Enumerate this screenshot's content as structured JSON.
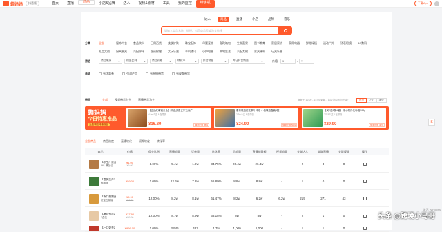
{
  "brand": {
    "name": "蝉妈妈",
    "version": "抖音版"
  },
  "nav": [
    {
      "label": "首页"
    },
    {
      "label": "直播"
    },
    {
      "label": "商品"
    },
    {
      "label": "小店&品牌"
    },
    {
      "label": "达人"
    },
    {
      "label": "视频&素材"
    },
    {
      "label": "工具"
    },
    {
      "label": "我的监控"
    },
    {
      "label": "蝉手机"
    }
  ],
  "top_right": {
    "button": "下载App"
  },
  "search_tabs": [
    "达人",
    "商品",
    "直播",
    "小店",
    "品牌",
    "音乐"
  ],
  "search": {
    "placeholder": "请输入商品名称、链接、抖音商品号或淘宝链接"
  },
  "filters": {
    "category_label": "分类",
    "categories": [
      "全部",
      "服饰内衣",
      "食品饮料",
      "日用百货",
      "美妆护肤",
      "珠宝配饰",
      "母婴宠物",
      "鞋靴箱包",
      "生鲜蔬果",
      "图书教育",
      "家居家纺",
      "家用电器",
      "鲜花绿植",
      "运动户外",
      "钟表眼镜",
      "3C数码",
      "礼品文创",
      "厨具餐具",
      "汽配摩托",
      "医药保健",
      "文玩乐器",
      "手机通讯",
      "小护电器",
      "本地生活",
      "汽配其他",
      "家具建材",
      "玩具乐器"
    ],
    "screen_label": "筛选",
    "selects": [
      "商品来源",
      "佣金比例",
      "商品价格",
      "转化率",
      "抖音销量",
      "昨日抖音销量",
      "价格"
    ],
    "price_range": {
      "from": "¥",
      "to": "¥"
    },
    "advanced_label": "高级",
    "checkboxes": [
      "有优惠券",
      "引流产品",
      "有直播带货",
      "有视频带货"
    ]
  },
  "product_tabs": {
    "label": "带货",
    "tabs": [
      "全部",
      "视频带货为主",
      "直播带货为主"
    ],
    "update": "数据于 12:00 - 14:00 更新，监控范围如何计算？",
    "periods": [
      "昨日",
      "7天",
      "30天"
    ]
  },
  "banner": {
    "title1": "蝉妈妈",
    "title2": "今日特惠推品",
    "badge": "免费领取特惠推品",
    "cards": [
      {
        "name": "【正品红薯蜜汁鱼】鲜活山楂 正宗云南产",
        "sub": "4.9w个达人在带货",
        "price": "¥16.80",
        "tag": "佣金比例 45%"
      },
      {
        "name": "春茶现泡红花茶叶冲泡 小包袋泡盒装3罐",
        "sub": "2.3w个达人在带货",
        "price": "¥24.90",
        "tag": "佣金比例 50%"
      },
      {
        "name": "【买2送2发4罐】 净水机净化冰箱500g",
        "sub": "2793个达人在带货",
        "price": "¥29.90",
        "tag": "佣金比例 40%"
      }
    ]
  },
  "sort_tabs": [
    "全部商品",
    "商品热度",
    "直播转化",
    "视频转化",
    "转化率"
  ],
  "table": {
    "headers": [
      "商品",
      "价格",
      "佣金比例",
      "直播销量",
      "订单量",
      "转化率",
      "总销量",
      "直播销量额",
      "视频销量",
      "关联达人",
      "关联直播",
      "关联视频",
      "操作"
    ],
    "rows": [
      {
        "name": "【原生厂家直销】",
        "name2": "96】黑加仑",
        "price": "¥1.00",
        "price2": "¥9.00",
        "commission": "1.00%",
        "live_sales": "5.4w",
        "orders": "1.9w",
        "conversion": "34.75%",
        "total": "26.4w",
        "live_amount": "26.4w",
        "video_sales": "-",
        "authors": "2",
        "lives": "3",
        "videos": "0"
      },
      {
        "name": "【重庆生产】",
        "name2": "鲜糯糯",
        "price": "¥59.00",
        "price2": "",
        "commission": "1.00%",
        "live_sales": "12.6w",
        "orders": "7.2w",
        "conversion": "56.89%",
        "total": "8.8w",
        "live_amount": "8.8w",
        "video_sales": "-",
        "authors": "1",
        "lives": "0",
        "videos": "0"
      },
      {
        "name": "【新口感嫩蛋",
        "name2": "红宝石辣椒",
        "price": "¥9.90",
        "price2": "¥19.90",
        "commission": "12.00%",
        "live_sales": "8.2w",
        "orders": "8.1w",
        "conversion": "61.47%",
        "total": "8.2w",
        "live_amount": "6.2w",
        "video_sales": "6.2w",
        "authors": "219",
        "lives": "271",
        "videos": "43"
      },
      {
        "name": "【康舒推荐】",
        "name2": "3盒装",
        "price": "¥27.90",
        "price2": "¥69.90",
        "commission": "12.00%",
        "live_sales": "8.7w",
        "orders": "8.9w",
        "conversion": "68.18%",
        "total": "8w",
        "live_amount": "8w",
        "video_sales": "-",
        "authors": "2",
        "lives": "1",
        "videos": "0"
      },
      {
        "name": "【一月好茶】",
        "name2": "精选",
        "price": "¥999.00",
        "price2": "",
        "commission": "1.00%",
        "live_sales": "3,946",
        "orders": "487",
        "conversion": "1.7w",
        "total": "1,000",
        "live_amount": "1,000",
        "video_sales": "-",
        "authors": "1",
        "lives": "1",
        "videos": "0"
      }
    ]
  },
  "watermark": "头条 @跨境小马哥",
  "watermark2": "激活 Windows",
  "colors": {
    "accent": "#ff5a2c"
  }
}
